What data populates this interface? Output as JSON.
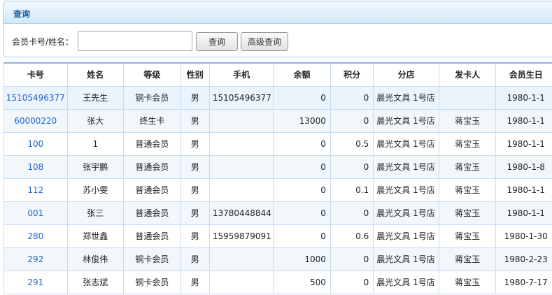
{
  "panel": {
    "title": "查询",
    "search_label": "会员卡号/姓名：",
    "search_value": "",
    "search_button": "查询",
    "advanced_button": "高级查询"
  },
  "table": {
    "headers": [
      "卡号",
      "姓名",
      "等级",
      "性别",
      "手机",
      "余额",
      "积分",
      "分店",
      "发卡人",
      "会员生日"
    ],
    "rows": [
      [
        "15105496377",
        "王先生",
        "铜卡会员",
        "男",
        "15105496377",
        "0",
        "0",
        "晨光文具 1号店",
        "",
        "1980-1-1"
      ],
      [
        "60000220",
        "张大",
        "终生卡",
        "男",
        "",
        "13000",
        "0",
        "晨光文具 1号店",
        "蒋宝玉",
        "1980-1-1"
      ],
      [
        "100",
        "1",
        "普通会员",
        "男",
        "",
        "0",
        "0.5",
        "晨光文具 1号店",
        "蒋宝玉",
        "1980-1-1"
      ],
      [
        "108",
        "张宇鹏",
        "普通会员",
        "男",
        "",
        "0",
        "0",
        "晨光文具 1号店",
        "蒋宝玉",
        "1980-1-8"
      ],
      [
        "112",
        "苏小雯",
        "普通会员",
        "男",
        "",
        "0",
        "0.1",
        "晨光文具 1号店",
        "蒋宝玉",
        "1980-1-1"
      ],
      [
        "001",
        "张三",
        "普通会员",
        "男",
        "13780448844",
        "0",
        "0",
        "晨光文具 1号店",
        "蒋宝玉",
        "1980-1-1"
      ],
      [
        "280",
        "郑世鑫",
        "普通会员",
        "男",
        "15959879091",
        "0",
        "0.6",
        "晨光文具 1号店",
        "蒋宝玉",
        "1980-1-30"
      ],
      [
        "292",
        "林俊伟",
        "铜卡会员",
        "男",
        "",
        "1000",
        "0",
        "晨光文具 1号店",
        "蒋宝玉",
        "1980-2-23"
      ],
      [
        "291",
        "张志斌",
        "铜卡会员",
        "男",
        "",
        "500",
        "0",
        "晨光文具 1号店",
        "蒋宝玉",
        "1980-7-17"
      ]
    ]
  }
}
